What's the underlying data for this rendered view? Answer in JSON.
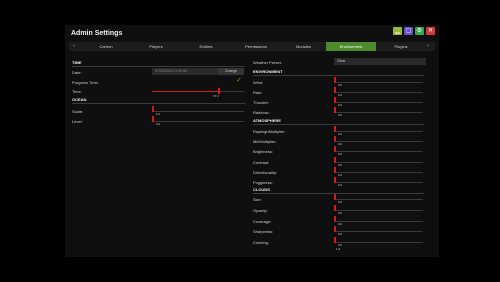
{
  "title": "Admin Settings",
  "colors": {
    "accent_tab": "#4f8a2d",
    "slider_knob": "#d11a1a",
    "checkmark": "#4caf27"
  },
  "window_buttons": [
    {
      "name": "minimize",
      "color": "#9bb63a"
    },
    {
      "name": "maximize",
      "color": "#6a4fc4"
    },
    {
      "name": "settings",
      "color": "#3aa64a"
    },
    {
      "name": "close",
      "color": "#d23b3b"
    }
  ],
  "tabs": [
    "Carbon",
    "Players",
    "Entities",
    "Permissions",
    "Modules",
    "Environment",
    "Plugins"
  ],
  "active_tab": "Environment",
  "left": {
    "time_section": "TIME",
    "date_label": "Date:",
    "date_value": "07/22/2024 11:09:59",
    "change_label": "Change",
    "progress_label": "Progress Time:",
    "time_label": "Time:",
    "time_value": "17.2",
    "time_fraction": 0.72,
    "ocean_section": "OCEAN",
    "scale_label": "Scale:",
    "scale_value": "1.0",
    "level_label": "Level:",
    "level_value": "0.0"
  },
  "right": {
    "weather_label": "Weather Preset:",
    "weather_value": "Clear",
    "env_section": "ENVIRONMENT",
    "env": [
      {
        "label": "Wind:",
        "value": "0.0"
      },
      {
        "label": "Rain:",
        "value": "0.0"
      },
      {
        "label": "Thunder:",
        "value": "0.0"
      },
      {
        "label": "Rainbow:",
        "value": "0.0"
      }
    ],
    "atm_section": "ATMOSPHERE",
    "atm": [
      {
        "label": "RayleighMultiplier:",
        "value": "0.0"
      },
      {
        "label": "MieMultiplier:",
        "value": "0.0"
      },
      {
        "label": "Brightness:",
        "value": "0.0"
      },
      {
        "label": "Contrast:",
        "value": "0.0"
      },
      {
        "label": "Directionality:",
        "value": "0.0"
      },
      {
        "label": "Fogginess:",
        "value": "0.0"
      }
    ],
    "clouds_section": "CLOUDS",
    "clouds": [
      {
        "label": "Size:",
        "value": "0.0"
      },
      {
        "label": "Opacity:",
        "value": "0.0"
      },
      {
        "label": "Coverage:",
        "value": "0.0"
      },
      {
        "label": "Sharpness:",
        "value": "0.0"
      },
      {
        "label": "Coloring:",
        "value": "0.0"
      }
    ],
    "bottom_value": "1.0"
  }
}
